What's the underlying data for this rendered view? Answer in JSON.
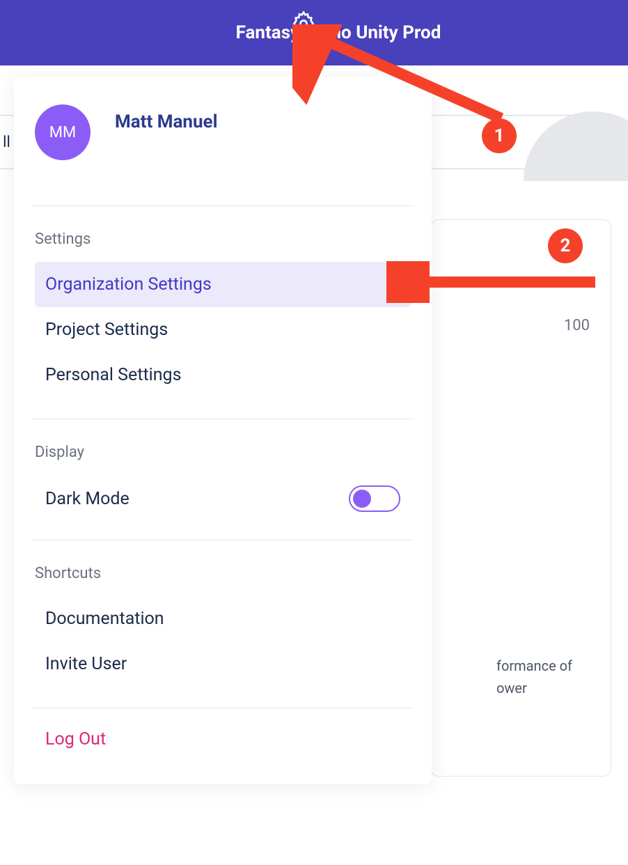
{
  "header": {
    "title": "Fantasy Demo Unity Prod"
  },
  "left_fragment": "ll",
  "gauge_value": "100",
  "card_text_line1": "formance of",
  "card_text_line2": "ower",
  "popup": {
    "user": {
      "initials": "MM",
      "name": "Matt Manuel"
    },
    "settings_label": "Settings",
    "settings_items": [
      {
        "label": "Organization Settings",
        "highlighted": true
      },
      {
        "label": "Project Settings",
        "highlighted": false
      },
      {
        "label": "Personal Settings",
        "highlighted": false
      }
    ],
    "display_label": "Display",
    "dark_mode_label": "Dark Mode",
    "shortcuts_label": "Shortcuts",
    "shortcuts_items": [
      {
        "label": "Documentation"
      },
      {
        "label": "Invite User"
      }
    ],
    "logout_label": "Log Out"
  },
  "annotations": {
    "badge1": "1",
    "badge2": "2"
  }
}
